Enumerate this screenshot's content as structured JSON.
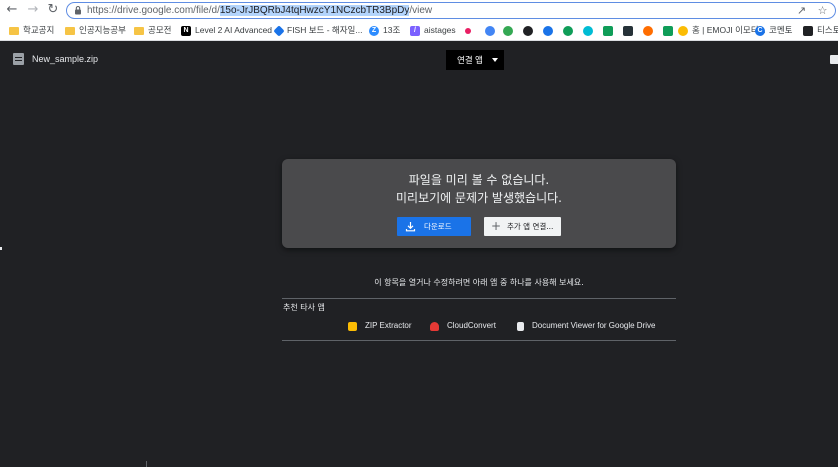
{
  "browser": {
    "url_base": "https://drive.google.com/file/d/",
    "url_selected": "15o-JrJBQRbJ4tqHwzcY1NCzcbTR3BpDy",
    "url_rest": "/view",
    "bookmarks": [
      {
        "label": "학교공지",
        "icon": "folder-icon"
      },
      {
        "label": "인공지능공부",
        "icon": "folder-icon"
      },
      {
        "label": "공모전",
        "icon": "folder-icon"
      },
      {
        "label": "Level 2 AI Advanced",
        "icon": "notion-icon",
        "icon_color": "#000000"
      },
      {
        "label": "FISH 보드 - 해자일...",
        "icon": "diamond-icon",
        "icon_color": "#1a73e8"
      },
      {
        "label": "13조",
        "icon": "z-icon",
        "icon_color": "#2d8cff"
      },
      {
        "label": "aistages",
        "icon": "aistages-icon",
        "icon_color": "#7b61ff"
      },
      {
        "label": "홈 | EMOJI 이모티...",
        "icon": "emoji-icon",
        "icon_color": "#fbbc04"
      },
      {
        "label": "코멘토",
        "icon": "comento-icon",
        "icon_color": "#1a73e8"
      },
      {
        "label": "티스토",
        "icon": "tistory-icon",
        "icon_color": "#202124"
      }
    ],
    "bookmark_icons": [
      {
        "icon": "favicon-1",
        "color": "#e91e63"
      },
      {
        "icon": "favicon-2",
        "color": "#4285f4"
      },
      {
        "icon": "favicon-3",
        "color": "#34a853"
      },
      {
        "icon": "github-icon",
        "color": "#202124"
      },
      {
        "icon": "favicon-5",
        "color": "#1a73e8"
      },
      {
        "icon": "favicon-6",
        "color": "#0f9d58"
      },
      {
        "icon": "favicon-7",
        "color": "#00bcd4"
      },
      {
        "icon": "favicon-8",
        "color": "#0f9d58"
      },
      {
        "icon": "favicon-9",
        "color": "#263238"
      },
      {
        "icon": "favicon-10",
        "color": "#ff6d00"
      },
      {
        "icon": "favicon-11",
        "color": "#0f9d58"
      }
    ]
  },
  "viewer": {
    "file_name": "New_sample.zip",
    "open_with": "연결 앱",
    "error_line1": "파일을 미리 볼 수 없습니다.",
    "error_line2": "미리보기에 문제가 발생했습니다.",
    "download_label": "다운로드",
    "more_apps_label": "추가 앱 연결...",
    "helper_text": "이 항목을 열거나 수정하려면 아래 앱 중 하나를 사용해 보세요.",
    "suggested_label": "추천 타사 앱",
    "apps": [
      {
        "label": "ZIP Extractor",
        "color": "#fbbc04"
      },
      {
        "label": "CloudConvert",
        "color": "#e53935"
      },
      {
        "label": "Document Viewer for Google Drive",
        "color": "#e8eaed"
      }
    ]
  }
}
